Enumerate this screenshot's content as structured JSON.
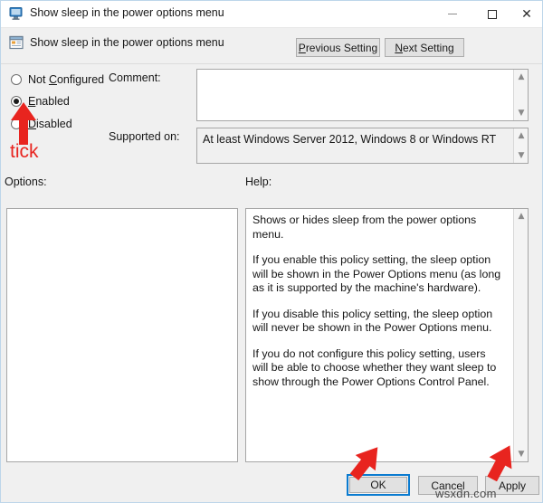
{
  "window": {
    "title": "Show sleep in the power options menu",
    "icon": "monitor-policy-icon",
    "controls": {
      "minimize": "–",
      "maximize": "□",
      "close": "✕"
    }
  },
  "header": {
    "setting_name": "Show sleep in the power options menu",
    "icon": "policy-setting-icon",
    "previous_button": "Previous Setting",
    "previous_button_accel": "P",
    "next_button": "Next Setting",
    "next_button_accel": "N"
  },
  "state": {
    "options": [
      {
        "id": "not-configured",
        "label": "Not Configured",
        "accel": "C",
        "selected": false
      },
      {
        "id": "enabled",
        "label": "Enabled",
        "accel": "E",
        "selected": true
      },
      {
        "id": "disabled",
        "label": "Disabled",
        "accel": "D",
        "selected": false
      }
    ],
    "selected_value": "Enabled"
  },
  "fields": {
    "comment_label": "Comment:",
    "comment_value": "",
    "supported_label": "Supported on:",
    "supported_value": "At least Windows Server 2012, Windows 8 or Windows RT"
  },
  "panels": {
    "options_label": "Options:",
    "options_content": "",
    "help_label": "Help:",
    "help_paragraphs": [
      "Shows or hides sleep from the power options menu.",
      "If you enable this policy setting, the sleep option will be shown in the Power Options menu (as long as it is supported by the machine's hardware).",
      "If you disable this policy setting, the sleep option will never be shown in the Power Options menu.",
      "If you do not configure this policy setting, users will be able to choose whether they want sleep to show through the Power Options Control Panel."
    ]
  },
  "footer": {
    "ok": "OK",
    "cancel": "Cancel",
    "apply": "Apply",
    "focused_button": "OK"
  },
  "annotations": {
    "tick_label": "tick",
    "accent_color": "#e8241f",
    "arrow_enabled_target": "enabled-radio",
    "arrow_ok_target": "ok-button",
    "arrow_apply_target": "apply-button",
    "watermark": "wsxdn.com"
  },
  "colors": {
    "dialog_background": "#f0f0f0",
    "titlebar_background": "#ffffff",
    "field_background": "#ffffff",
    "focus_border": "#0a7bd0",
    "annotation_red": "#e8241f"
  }
}
